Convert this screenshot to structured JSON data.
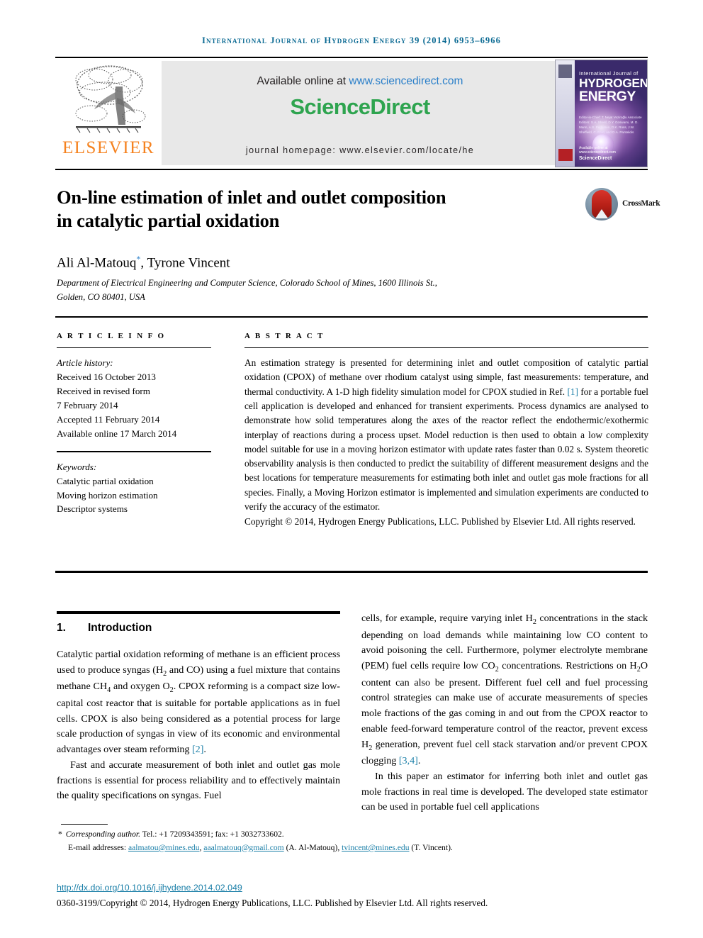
{
  "running_head": "International Journal of Hydrogen Energy 39 (2014) 6953–6966",
  "masthead": {
    "publisher_name": "ELSEVIER",
    "available_prefix": "Available online at ",
    "available_url": "www.sciencedirect.com",
    "sciencedirect_logo_a": "Science",
    "sciencedirect_logo_b": "Direct",
    "journal_homepage": "journal homepage: www.elsevier.com/locate/he",
    "cover": {
      "line1": "International Journal of",
      "line2": "HYDROGEN",
      "line3": "ENERGY",
      "editors": "Editor-in-Chief:  T. Nejat Veziroğlu\nAssociate Editors:  S.A. Sherif, D.Y. Goswami, M. D. Mann, A.S. Pedersen, D.K. Ross, J.W. Sheffield, C. Ford, and D.A. Pantalidis",
      "footer_a": "Available online at www.sciencedirect.com",
      "footer_b": "ScienceDirect"
    }
  },
  "article": {
    "title_line1": "On-line estimation of inlet and outlet composition",
    "title_line2": "in catalytic partial oxidation",
    "crossmark_label": "CrossMark",
    "authors": "Ali Al-Matouq",
    "authors_rest": ", Tyrone Vincent",
    "corresponding_marker": "*",
    "affiliation_line1": "Department of Electrical Engineering and Computer Science, Colorado School of Mines, 1600 Illinois St.,",
    "affiliation_line2": "Golden, CO 80401, USA"
  },
  "info": {
    "section_label": "A R T I C L E  I N F O",
    "history_label": "Article history:",
    "history": [
      "Received 16 October 2013",
      "Received in revised form",
      "7 February 2014",
      "Accepted 11 February 2014",
      "Available online 17 March 2014"
    ],
    "keywords_label": "Keywords:",
    "keywords": [
      "Catalytic partial oxidation",
      "Moving horizon estimation",
      "Descriptor systems"
    ]
  },
  "abstract": {
    "section_label": "A B S T R A C T",
    "part1": "An estimation strategy is presented for determining inlet and outlet composition of catalytic partial oxidation (CPOX) of methane over rhodium catalyst using simple, fast measurements: temperature, and thermal conductivity. A 1-D high fidelity simulation model for CPOX studied in Ref. ",
    "ref1": "[1]",
    "part2": " for a portable fuel cell application is developed and enhanced for transient experiments. Process dynamics are analysed to demonstrate how solid temperatures along the axes of the reactor reflect the endothermic/exothermic interplay of reactions during a process upset. Model reduction is then used to obtain a low complexity model suitable for use in a moving horizon estimator with update rates faster than 0.02 s. System theoretic observability analysis is then conducted to predict the suitability of different measurement designs and the best locations for temperature measurements for estimating both inlet and outlet gas mole fractions for all species. Finally, a Moving Horizon estimator is implemented and simulation experiments are conducted to verify the accuracy of the estimator.",
    "copyright": "Copyright © 2014, Hydrogen Energy Publications, LLC. Published by Elsevier Ltd. All rights reserved."
  },
  "introduction": {
    "number": "1.",
    "title": "Introduction",
    "left_p1_a": "Catalytic partial oxidation reforming of methane is an efficient process used to produce syngas (H",
    "left_p1_sub1": "2",
    "left_p1_b": " and CO) using a fuel mixture that contains methane CH",
    "left_p1_sub2": "4",
    "left_p1_c": " and oxygen O",
    "left_p1_sub3": "2",
    "left_p1_d": ". CPOX reforming is a compact size low-capital cost reactor that is suitable for portable applications as in fuel cells. CPOX is also being considered as a potential process for large scale production of syngas in view of its economic and environmental advantages over steam reforming ",
    "left_p1_ref": "[2]",
    "left_p1_e": ".",
    "left_p2": "Fast and accurate measurement of both inlet and outlet gas mole fractions is essential for process reliability and to effectively maintain the quality specifications on syngas. Fuel",
    "right_p1_a": "cells, for example, require varying inlet H",
    "right_p1_sub1": "2",
    "right_p1_b": " concentrations in the stack depending on load demands while maintaining low CO content to avoid poisoning the cell. Furthermore, polymer electrolyte membrane (PEM) fuel cells require low CO",
    "right_p1_sub2": "2",
    "right_p1_c": " concentrations. Restrictions on H",
    "right_p1_sub3": "2",
    "right_p1_d": "O content can also be present. Different fuel cell and fuel processing control strategies can make use of accurate measurements of species mole fractions of the gas coming in and out from the CPOX reactor to enable feed-forward temperature control of the reactor, prevent excess H",
    "right_p1_sub4": "2",
    "right_p1_e": " generation, prevent fuel cell stack starvation and/or prevent CPOX clogging ",
    "right_p1_ref": "[3,4]",
    "right_p1_f": ".",
    "right_p2": "In this paper an estimator for inferring both inlet and outlet gas mole fractions in real time is developed. The developed state estimator can be used in portable fuel cell applications"
  },
  "footer": {
    "corresponding_marker": "*",
    "corresponding_label": "Corresponding author.",
    "corresponding_contact": " Tel.: +1 7209343591; fax: +1 3032733602.",
    "email_label": "E-mail addresses: ",
    "email1": "aalmatou@mines.edu",
    "email2": "aaalmatouq@gmail.com",
    "email1_owner": " (A. Al-Matouq), ",
    "email3": "tvincent@mines.edu",
    "email3_owner": " (T. Vincent).",
    "doi": "http://dx.doi.org/10.1016/j.ijhydene.2014.02.049",
    "issn_copyright": "0360-3199/Copyright © 2014, Hydrogen Energy Publications, LLC. Published by Elsevier Ltd. All rights reserved."
  },
  "colors": {
    "running_head": "#0b6a93",
    "link": "#1b7fa8",
    "elsevier_orange": "#F5821F",
    "sciencedirect_green": "#2ea44f"
  }
}
